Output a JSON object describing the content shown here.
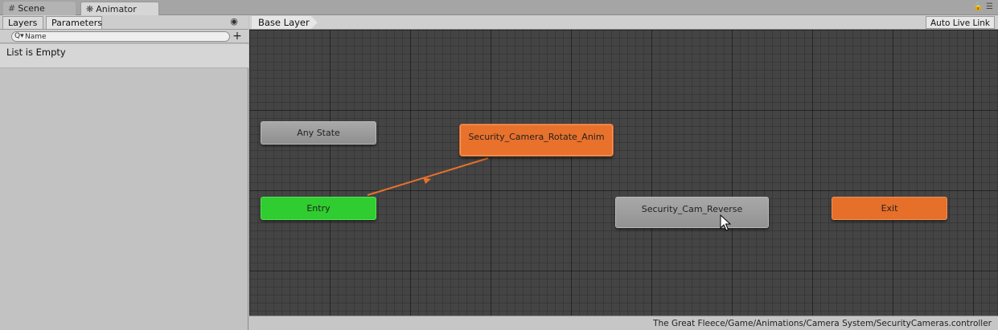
{
  "window_tabs": [
    {
      "label": "Scene",
      "icon": "grid-icon"
    },
    {
      "label": "Animator",
      "icon": "animator-icon"
    }
  ],
  "window_controls": {
    "lock_icon": "lock-icon",
    "menu_icon": "menu-icon"
  },
  "left_panel": {
    "tabs": [
      "Layers",
      "Parameters"
    ],
    "search": {
      "placeholder": "Name",
      "value": ""
    },
    "empty_message": "List is Empty"
  },
  "graph": {
    "breadcrumb": "Base Layer",
    "auto_live_link": "Auto Live Link",
    "nodes": {
      "any_state": "Any State",
      "entry": "Entry",
      "default_state": "Security_Camera_Rotate_Anim",
      "reverse_state": "Security_Cam_Reverse",
      "exit": "Exit"
    },
    "colors": {
      "canvas": "#444444",
      "default_state": "#e8712c",
      "entry": "#2fcd2f",
      "exit": "#e66f2a",
      "state": "#9e9e9e"
    }
  },
  "footer": {
    "asset_path": "The Great Fleece/Game/Animations/Camera System/SecurityCameras.controller"
  }
}
